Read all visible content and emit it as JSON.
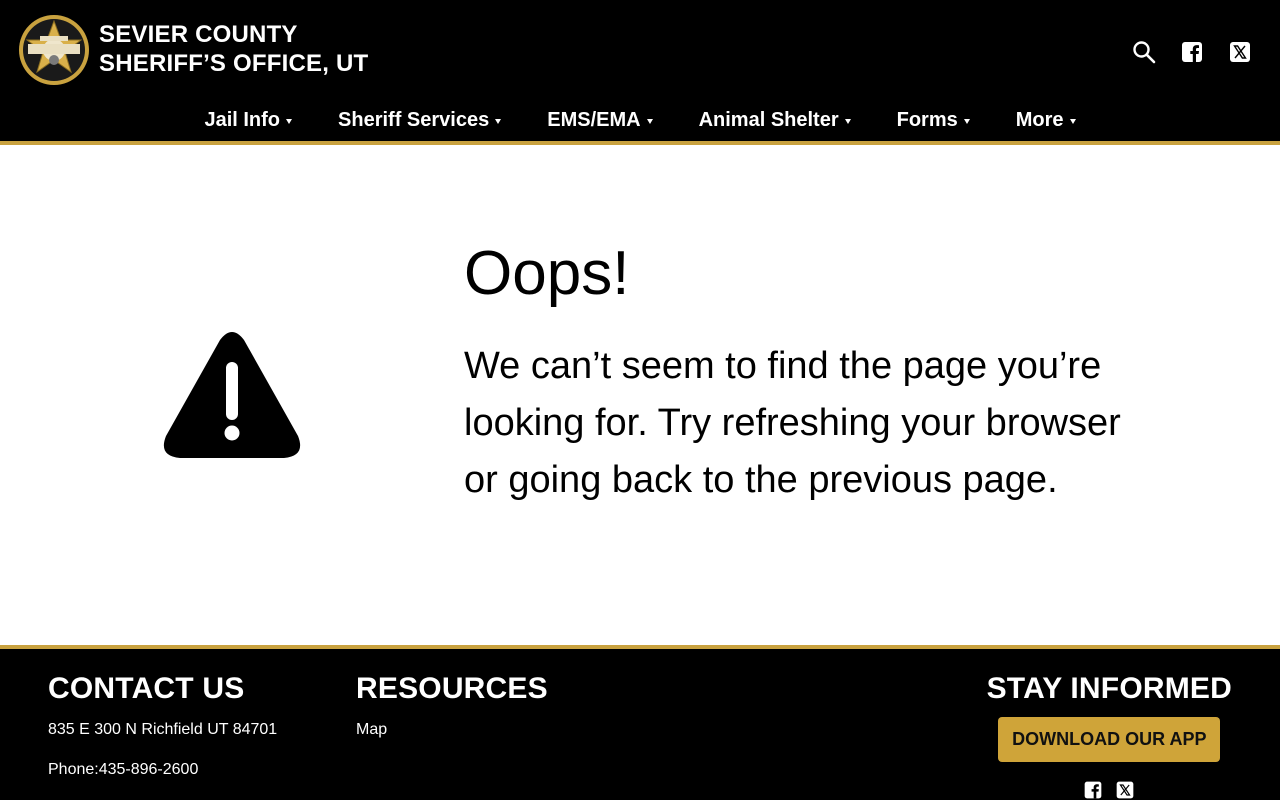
{
  "header": {
    "brand_line1": "SEVIER COUNTY",
    "brand_line2": "SHERIFF’S OFFICE, UT",
    "icons": [
      "search-icon",
      "facebook-icon",
      "x-twitter-icon"
    ]
  },
  "nav": {
    "items": [
      {
        "label": "Jail Info"
      },
      {
        "label": "Sheriff Services"
      },
      {
        "label": "EMS/EMA"
      },
      {
        "label": "Animal Shelter"
      },
      {
        "label": "Forms"
      },
      {
        "label": "More"
      }
    ]
  },
  "main": {
    "icon": "warning-icon",
    "title": "Oops!",
    "message": "We can’t seem to find the page you’re looking for. Try refreshing your browser or going back to the previous page."
  },
  "footer": {
    "contact": {
      "title": "CONTACT US",
      "address": "835 E 300 N Richfield UT 84701",
      "phone": "Phone:435-896-2600"
    },
    "resources": {
      "title": "RESOURCES",
      "links": [
        {
          "label": "Map"
        }
      ]
    },
    "stay": {
      "title": "STAY INFORMED",
      "app_button": "DOWNLOAD OUR APP",
      "icons": [
        "facebook-icon",
        "x-twitter-icon"
      ]
    }
  },
  "colors": {
    "header_bg": "#000000",
    "accent_gold": "#c9a23f",
    "button_gold": "#cfa439"
  }
}
